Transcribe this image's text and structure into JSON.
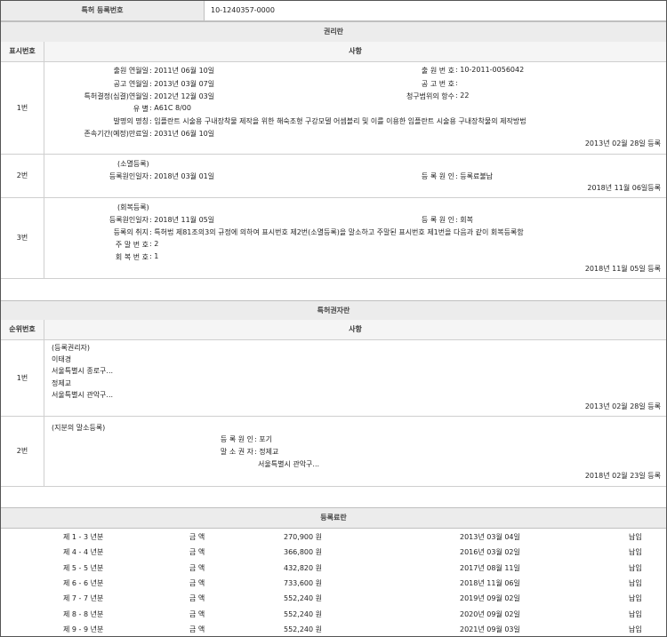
{
  "top": {
    "label": "특허 등록번호",
    "value": "10-1240357-0000"
  },
  "rights": {
    "title": "권리란",
    "col_num": "표시번호",
    "col_body": "사항",
    "r1": {
      "num": "1번",
      "l1": "출원 연월일",
      "v1": ": 2011년 06월 10일",
      "l2": "공고 연월일",
      "v2": ": 2013년 03월 07일",
      "l3": "특허결정(심결)연월일",
      "v3": ": 2012년 12월 03일",
      "l4": "유 별",
      "v4": ": A61C 8/00",
      "l5": "발명의 명칭",
      "v5": ": 임플란트 시술용 구내장착물 제작을 위한 해숙조형 구강모델 어셈블리 및 이를 이용한 임플란트 시술용 구내장착물의 제작방법",
      "l6": "존속기간(예정)만료일",
      "v6": ": 2031년 06월 10일",
      "r_l1": "출 원 번 호",
      "r_v1": ": 10-2011-0056042",
      "r_l2": "공 고 번 호",
      "r_v2": ":",
      "r_l3": "청구범위의 항수",
      "r_v3": ": 22",
      "date": "2013년 02월 28일 등록"
    },
    "r2": {
      "num": "2번",
      "head": "(소멸등록)",
      "l1": "등록원인일자",
      "v1": ": 2018년 03월 01일",
      "r_l1": "등 록 원 인",
      "r_v1": ": 등록료불납",
      "date": "2018년 11월 06일등록"
    },
    "r3": {
      "num": "3번",
      "head": "(회복등록)",
      "l1": "등록원인일자",
      "v1": ": 2018년 11월 05일",
      "l2": "등록의 취지",
      "v2": ": 특허법 제81조의3의 규정에 의하여 표시번호 제2번(소멸등록)을 말소하고 주말된 표시번호 제1번을 다음과 같이 회복등록함",
      "l3": "주 말 번 호",
      "v3": ": 2",
      "l4": "회 복 번 호",
      "v4": ": 1",
      "r_l1": "등 록 원 인",
      "r_v1": ": 회복",
      "date": "2018년 11월 05일 등록"
    }
  },
  "holders": {
    "title": "특허권자란",
    "col_num": "순위번호",
    "col_body": "사항",
    "r1": {
      "num": "1번",
      "lines": [
        "(등록권리자)",
        "이태경",
        "서울특별시 종로구...",
        "정제교",
        "서울특별시 관악구..."
      ],
      "date": "2013년 02월 28일 등록"
    },
    "r2": {
      "num": "2번",
      "head": "(지분의 말소등록)",
      "l1": "등 록 원 인",
      "v1": ": 포기",
      "l2": "말 소 권 자",
      "v2": ": 정제교",
      "v3": "서울특별시 관악구...",
      "date": "2018년 02월 23일 등록"
    }
  },
  "fees": {
    "title": "등록료란",
    "rows": [
      {
        "year": "제 1 - 3 년분",
        "label": "금 액",
        "amount": "270,900 원",
        "date": "2013년 03월 04일",
        "status": "납입"
      },
      {
        "year": "제 4 - 4 년분",
        "label": "금 액",
        "amount": "366,800 원",
        "date": "2016년 03월 02일",
        "status": "납입"
      },
      {
        "year": "제 5 - 5 년분",
        "label": "금 액",
        "amount": "432,820 원",
        "date": "2017년 08월 11일",
        "status": "납입"
      },
      {
        "year": "제 6 - 6 년분",
        "label": "금 액",
        "amount": "733,600 원",
        "date": "2018년 11월 06일",
        "status": "납입"
      },
      {
        "year": "제 7 - 7 년분",
        "label": "금 액",
        "amount": "552,240 원",
        "date": "2019년 09월 02일",
        "status": "납입"
      },
      {
        "year": "제 8 - 8 년분",
        "label": "금 액",
        "amount": "552,240 원",
        "date": "2020년 09월 02일",
        "status": "납입"
      },
      {
        "year": "제 9 - 9 년분",
        "label": "금 액",
        "amount": "552,240 원",
        "date": "2021년 09월 03일",
        "status": "납입"
      }
    ]
  }
}
